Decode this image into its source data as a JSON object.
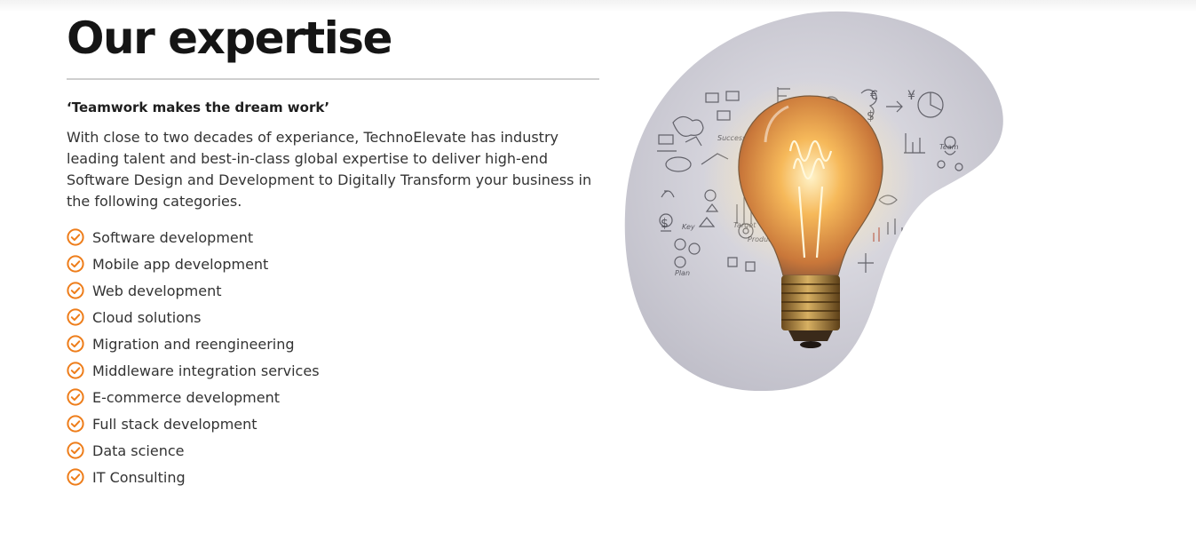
{
  "section": {
    "title": "Our expertise",
    "tagline": "‘Teamwork makes the dream work’",
    "intro": "With close to two decades of experiance, TechnoElevate has industry leading talent and best-in-class global expertise to deliver high-end Software Design and Development to Digitally Transform your business in the following categories."
  },
  "expertise": [
    {
      "label": "Software development"
    },
    {
      "label": "Mobile app development"
    },
    {
      "label": "Web development"
    },
    {
      "label": "Cloud solutions"
    },
    {
      "label": "Migration and reengineering"
    },
    {
      "label": "Middleware integration services"
    },
    {
      "label": "E-commerce development"
    },
    {
      "label": "Full stack development"
    },
    {
      "label": "Data science"
    },
    {
      "label": "IT Consulting"
    }
  ],
  "image": {
    "icon": "lightbulb-illustration",
    "sketch_labels": [
      "Success",
      "Team",
      "Target",
      "Production",
      "Plan",
      "Key"
    ]
  },
  "colors": {
    "accent": "#ee7d1a",
    "title": "#151515",
    "text": "#333333",
    "divider": "#cfcfcf"
  }
}
